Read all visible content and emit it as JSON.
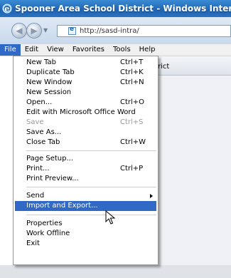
{
  "window": {
    "title": "Spooner Area School District - Windows Internet Exp",
    "icon": "ie-logo-icon"
  },
  "nav": {
    "back_icon": "back-arrow-icon",
    "forward_icon": "forward-arrow-icon",
    "url": "http://sasd-intra/"
  },
  "menubar": {
    "items": [
      {
        "label": "File"
      },
      {
        "label": "Edit"
      },
      {
        "label": "View"
      },
      {
        "label": "Favorites"
      },
      {
        "label": "Tools"
      },
      {
        "label": "Help"
      }
    ]
  },
  "tab": {
    "fragment": "rict"
  },
  "file_menu": {
    "items": [
      {
        "label": "New Tab",
        "shortcut": "Ctrl+T"
      },
      {
        "label": "Duplicate Tab",
        "shortcut": "Ctrl+K"
      },
      {
        "label": "New Window",
        "shortcut": "Ctrl+N"
      },
      {
        "label": "New Session",
        "shortcut": ""
      },
      {
        "label": "Open...",
        "shortcut": "Ctrl+O"
      },
      {
        "label": "Edit with Microsoft Office Word",
        "shortcut": ""
      },
      {
        "label": "Save",
        "shortcut": "Ctrl+S"
      },
      {
        "label": "Save As...",
        "shortcut": ""
      },
      {
        "label": "Close Tab",
        "shortcut": "Ctrl+W"
      },
      {
        "label": "Page Setup...",
        "shortcut": ""
      },
      {
        "label": "Print...",
        "shortcut": "Ctrl+P"
      },
      {
        "label": "Print Preview...",
        "shortcut": ""
      },
      {
        "label": "Send",
        "shortcut": ""
      },
      {
        "label": "Import and Export...",
        "shortcut": ""
      },
      {
        "label": "Properties",
        "shortcut": ""
      },
      {
        "label": "Work Offline",
        "shortcut": ""
      },
      {
        "label": "Exit",
        "shortcut": ""
      }
    ],
    "highlighted": "Import and Export...",
    "disabled": [
      "Save"
    ]
  },
  "colors": {
    "titlebar": "#1f63b0",
    "menu_highlight": "#3169c6"
  }
}
